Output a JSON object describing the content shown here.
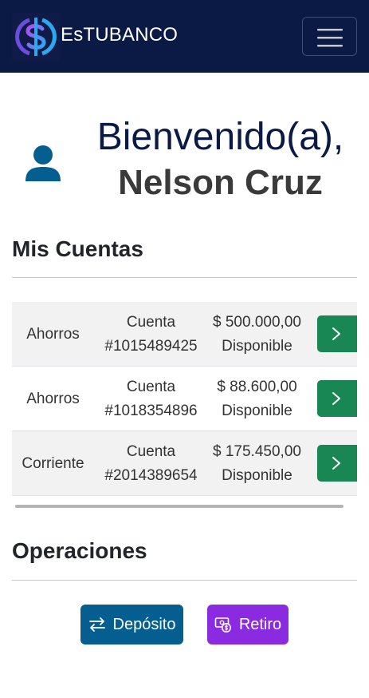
{
  "navbar": {
    "brand": "EsTUBANCO",
    "logo_icon": "dollar-s-logo-icon",
    "toggler_icon": "hamburger-menu-icon",
    "background": "#0b1a45"
  },
  "welcome": {
    "greeting": "Bienvenido(a),",
    "name": "Nelson Cruz",
    "user_icon": "user-icon"
  },
  "accounts": {
    "title": "Mis Cuentas",
    "rows": [
      {
        "type": "Ahorros",
        "label": "Cuenta",
        "number": "#1015489425",
        "balance": "$ 500.000,00",
        "status": "Disponible"
      },
      {
        "type": "Ahorros",
        "label": "Cuenta",
        "number": "#1018354896",
        "balance": "$ 88.600,00",
        "status": "Disponible"
      },
      {
        "type": "Corriente",
        "label": "Cuenta",
        "number": "#2014389654",
        "balance": "$ 175.450,00",
        "status": "Disponible"
      }
    ],
    "go_icon": "chevron-right-icon",
    "go_color": "#198754"
  },
  "operations": {
    "title": "Operaciones",
    "deposit_label": "Depósito",
    "deposit_icon": "arrows-exchange-icon",
    "deposit_color": "#045e8f",
    "withdraw_label": "Retiro",
    "withdraw_icon": "cash-coin-icon",
    "withdraw_color": "#8a2be2"
  }
}
